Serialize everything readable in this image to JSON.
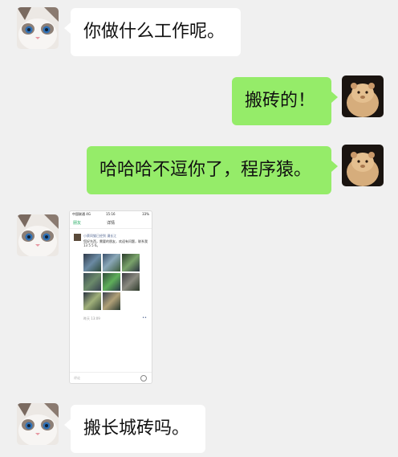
{
  "messages": [
    {
      "from": "friend",
      "text": "你做什么工作呢。"
    },
    {
      "from": "me",
      "text": "搬砖的！"
    },
    {
      "from": "me",
      "text": "哈哈哈不逗你了，程序猿。"
    },
    {
      "from": "friend",
      "type": "image"
    },
    {
      "from": "friend",
      "text": "搬长城砖吗。"
    }
  ],
  "shared_screenshot": {
    "status_carrier": "中国联通 4G",
    "status_time": "15:16",
    "status_battery": "33%",
    "nav_back": "朋友",
    "nav_title": "详情",
    "poster": "小蔡同猫已经到 漫长江",
    "body": "您好东西，需要的朋友，欢迎有问题，联系我 13 5 5 6。",
    "meta": "昨天 13:09",
    "input_placeholder": "评论"
  },
  "colors": {
    "background": "#f0f0f0",
    "bubble_in": "#ffffff",
    "bubble_out": "#95ec69"
  },
  "avatars": {
    "friend": "cat-avatar-icon",
    "me": "hamster-avatar-icon"
  }
}
